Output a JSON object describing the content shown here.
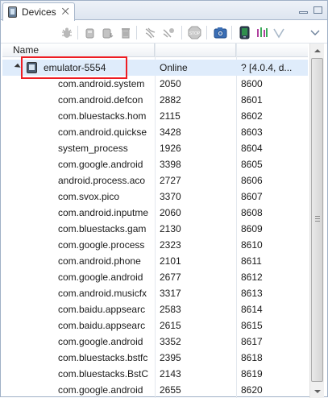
{
  "tab": {
    "label": "Devices",
    "close_symbol": "⨉"
  },
  "toolbar": {
    "icons": [
      "debug-icon",
      "update-heap-icon",
      "dump-hprof-icon",
      "cause-gc-icon",
      "update-threads-icon",
      "start-method-profiling-icon",
      "stop-process-icon",
      "screen-capture-icon",
      "dump-view-hierarchy-icon",
      "systrace-icon",
      "start-opengl-trace-icon"
    ]
  },
  "table": {
    "columns": [
      "Name",
      "",
      ""
    ],
    "device": {
      "name": "emulator-5554",
      "status": "Online",
      "version": "? [4.0.4, d..."
    },
    "processes": [
      {
        "name": "com.android.system",
        "pid": "2050",
        "port": "8600"
      },
      {
        "name": "com.android.defcon",
        "pid": "2882",
        "port": "8601"
      },
      {
        "name": "com.bluestacks.hom",
        "pid": "2115",
        "port": "8602"
      },
      {
        "name": "com.android.quickse",
        "pid": "3428",
        "port": "8603"
      },
      {
        "name": "system_process",
        "pid": "1926",
        "port": "8604"
      },
      {
        "name": "com.google.android",
        "pid": "3398",
        "port": "8605"
      },
      {
        "name": "android.process.aco",
        "pid": "2727",
        "port": "8606"
      },
      {
        "name": "com.svox.pico",
        "pid": "3370",
        "port": "8607"
      },
      {
        "name": "com.android.inputme",
        "pid": "2060",
        "port": "8608"
      },
      {
        "name": "com.bluestacks.gam",
        "pid": "2130",
        "port": "8609"
      },
      {
        "name": "com.google.process",
        "pid": "2323",
        "port": "8610"
      },
      {
        "name": "com.android.phone",
        "pid": "2101",
        "port": "8611"
      },
      {
        "name": "com.google.android",
        "pid": "2677",
        "port": "8612"
      },
      {
        "name": "com.android.musicfx",
        "pid": "3317",
        "port": "8613"
      },
      {
        "name": "com.baidu.appsearc",
        "pid": "2583",
        "port": "8614"
      },
      {
        "name": "com.baidu.appsearc",
        "pid": "2615",
        "port": "8615"
      },
      {
        "name": "com.google.android",
        "pid": "3352",
        "port": "8617"
      },
      {
        "name": "com.bluestacks.bstfc",
        "pid": "2395",
        "port": "8618"
      },
      {
        "name": "com.bluestacks.BstC",
        "pid": "2143",
        "port": "8619"
      },
      {
        "name": "com.google.android",
        "pid": "2655",
        "port": "8620"
      }
    ]
  },
  "colors": {
    "selection": "#dfecfb",
    "highlight_box": "#ee1d23",
    "tab_border": "#a9b8cc"
  }
}
